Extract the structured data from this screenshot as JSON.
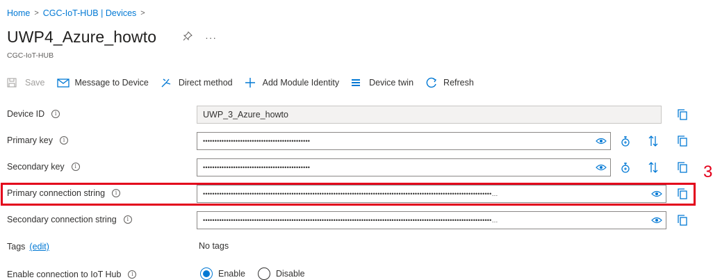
{
  "breadcrumb": {
    "items": [
      "Home",
      "CGC-IoT-HUB | Devices"
    ],
    "separator": ">"
  },
  "header": {
    "title": "UWP4_Azure_howto",
    "subtitle": "CGC-IoT-HUB",
    "more": "···"
  },
  "toolbar": {
    "save_label": "Save",
    "message_label": "Message to Device",
    "direct_method_label": "Direct method",
    "add_module_label": "Add Module Identity",
    "device_twin_label": "Device twin",
    "refresh_label": "Refresh"
  },
  "fields": {
    "device_id": {
      "label": "Device ID",
      "value": "UWP_3_Azure_howto"
    },
    "primary_key": {
      "label": "Primary key",
      "value": "••••••••••••••••••••••••••••••••••••••••••••••"
    },
    "secondary_key": {
      "label": "Secondary key",
      "value": "••••••••••••••••••••••••••••••••••••••••••••••"
    },
    "primary_conn": {
      "label": "Primary connection string",
      "value": "••••••••••••••••••••••••••••••••••••••••••••••••••••••••••••••••••••••••••••••••••••••••••••••••••••••••••••••••••••••••••••…"
    },
    "secondary_conn": {
      "label": "Secondary connection string",
      "value": "••••••••••••••••••••••••••••••••••••••••••••••••••••••••••••••••••••••••••••••••••••••••••••••••••••••••••••••••••••••••••••…"
    }
  },
  "tags": {
    "label": "Tags",
    "edit_label": "(edit)",
    "value": "No tags"
  },
  "enable_connection": {
    "label": "Enable connection to IoT Hub",
    "options": [
      "Enable",
      "Disable"
    ],
    "selected": "Enable"
  },
  "annotation": {
    "step_number": "3",
    "color": "#e3001b"
  },
  "colors": {
    "accent": "#0078d4",
    "text": "#323130",
    "muted": "#605e5c"
  }
}
